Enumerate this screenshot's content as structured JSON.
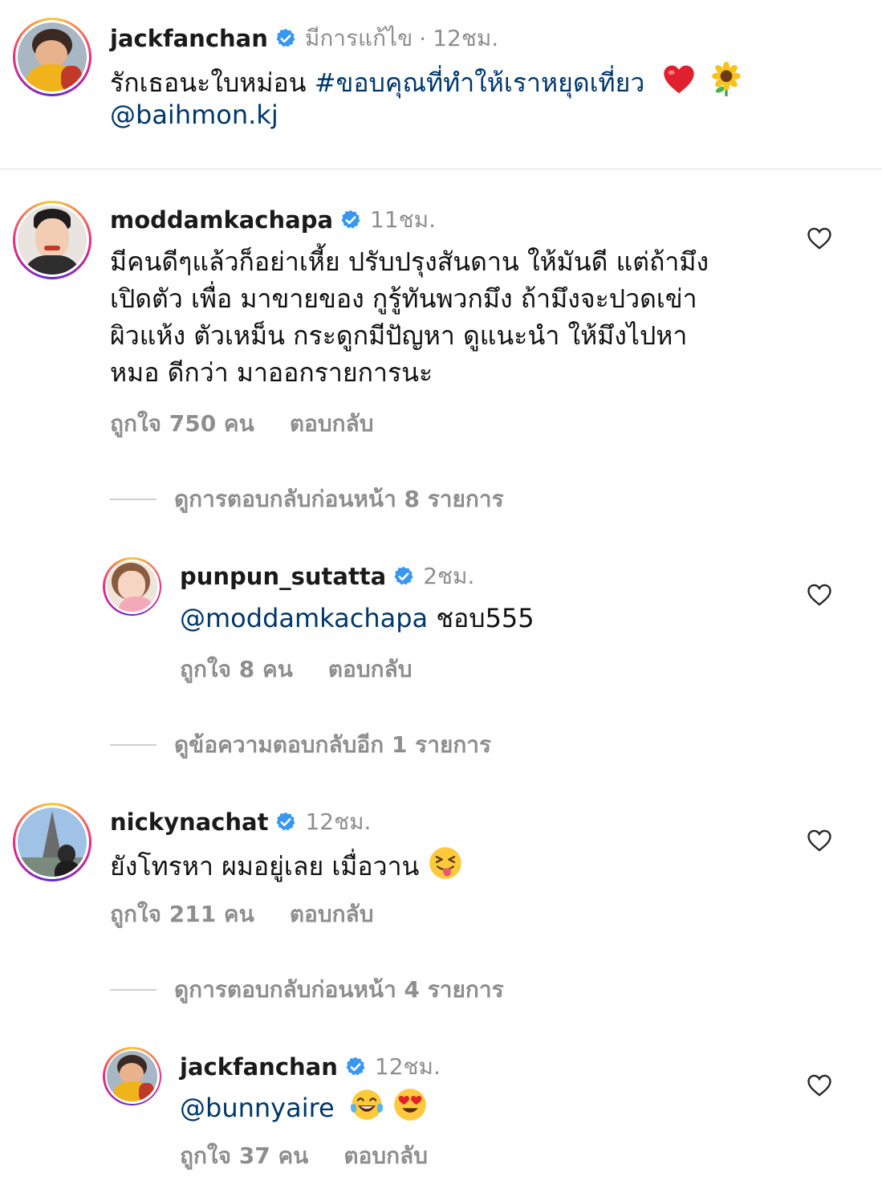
{
  "post": {
    "user": "jackfanchan",
    "edited": "มีการแก้ไข",
    "time": "12ชม.",
    "caption_text": "รักเธอนะใบหม่อน ",
    "hashtag": "#ขอบคุณที่ทำให้เราหยุดเที่ยว",
    "mention": "@baihmon.kj"
  },
  "comments": [
    {
      "user": "moddamkachapa",
      "time": "11ชม.",
      "lines": [
        "มีคนดีๆแล้วก็อย่าเหี้ย ปรับปรุงสันดาน ให้มันดี แต่ถ้ามึง",
        "เปิดตัว เพื่อ มาขายของ กูรู้ทันพวกมึง  ถ้ามึงจะปวดเข่า",
        "ผิวแห้ง ตัวเหม็น กระดูกมีปัญหา ดูแนะนำ ให้มึงไปหา",
        "หมอ ดีกว่า มาออกรายการนะ"
      ],
      "likes": "ถูกใจ 750 คน",
      "reply": "ตอบกลับ",
      "thread": "ดูการตอบกลับก่อนหน้า 8 รายการ"
    },
    {
      "user": "punpun_sutatta",
      "time": "2ชม.",
      "mention": "@moddamkachapa",
      "text": " ชอบ555",
      "likes": "ถูกใจ 8 คน",
      "reply": "ตอบกลับ",
      "thread": "ดูข้อความตอบกลับอีก 1 รายการ"
    },
    {
      "user": "nickynachat",
      "time": "12ชม.",
      "text": "ยังโทรหา ผมอยู่เลย เมื่อวาน ",
      "likes": "ถูกใจ 211 คน",
      "reply": "ตอบกลับ",
      "thread": "ดูการตอบกลับก่อนหน้า 4 รายการ"
    },
    {
      "user": "jackfanchan",
      "time": "12ชม.",
      "mention": "@bunnyaire",
      "likes": "ถูกใจ 37 คน",
      "reply": "ตอบกลับ"
    }
  ],
  "icons": {
    "verified": "verified-badge-icon",
    "heart": "heart-outline-icon",
    "emoji": [
      "red-heart-emoji",
      "sunflower-emoji",
      "squinting-tongue-emoji",
      "tears-of-joy-emoji",
      "heart-eyes-emoji"
    ]
  },
  "colors": {
    "link": "#00376b",
    "verified": "#3897f0",
    "muted": "#8e8e8e"
  }
}
